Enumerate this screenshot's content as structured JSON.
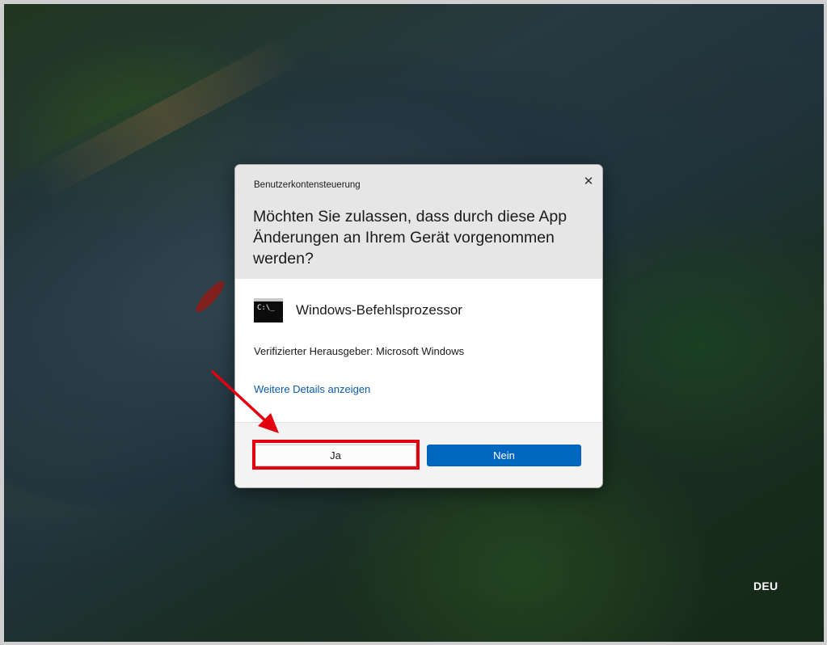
{
  "dialog": {
    "caption": "Benutzerkontensteuerung",
    "close_symbol": "✕",
    "question": "Möchten Sie zulassen, dass durch diese App Änderungen an Ihrem Gerät vorgenommen werden?",
    "app_icon": "command-prompt-icon",
    "app_icon_text": "C:\\_",
    "app_name": "Windows-Befehlsprozessor",
    "publisher": "Verifizierter Herausgeber: Microsoft Windows",
    "details_link": "Weitere Details anzeigen",
    "yes_label": "Ja",
    "no_label": "Nein"
  },
  "system": {
    "language": "DEU"
  },
  "colors": {
    "primary_button": "#0067c0",
    "annotation_red": "#e3000f",
    "link": "#0b5aa8"
  }
}
